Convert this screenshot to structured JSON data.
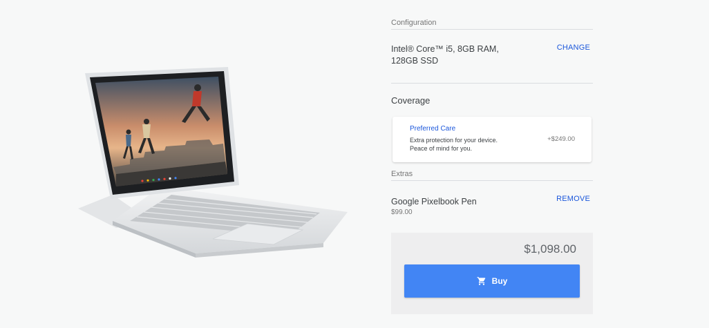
{
  "product": {
    "image_icon": "pixelbook-laptop-image"
  },
  "configuration": {
    "heading": "Configuration",
    "value": "Intel® Core™ i5, 8GB RAM, 128GB SSD",
    "change_label": "CHANGE"
  },
  "coverage": {
    "heading": "Coverage",
    "plan_name": "Preferred Care",
    "plan_desc_line1": "Extra protection for your device.",
    "plan_desc_line2": "Peace of mind for you.",
    "plan_price": "+$249.00"
  },
  "extras": {
    "heading": "Extras",
    "item_name": "Google Pixelbook Pen",
    "item_price": "$99.00",
    "remove_label": "REMOVE"
  },
  "summary": {
    "total": "$1,098.00",
    "buy_label": "Buy",
    "buy_icon": "cart-icon"
  },
  "colors": {
    "accent": "#4285f4",
    "link": "#1a56db",
    "background": "#f7f8f8"
  }
}
